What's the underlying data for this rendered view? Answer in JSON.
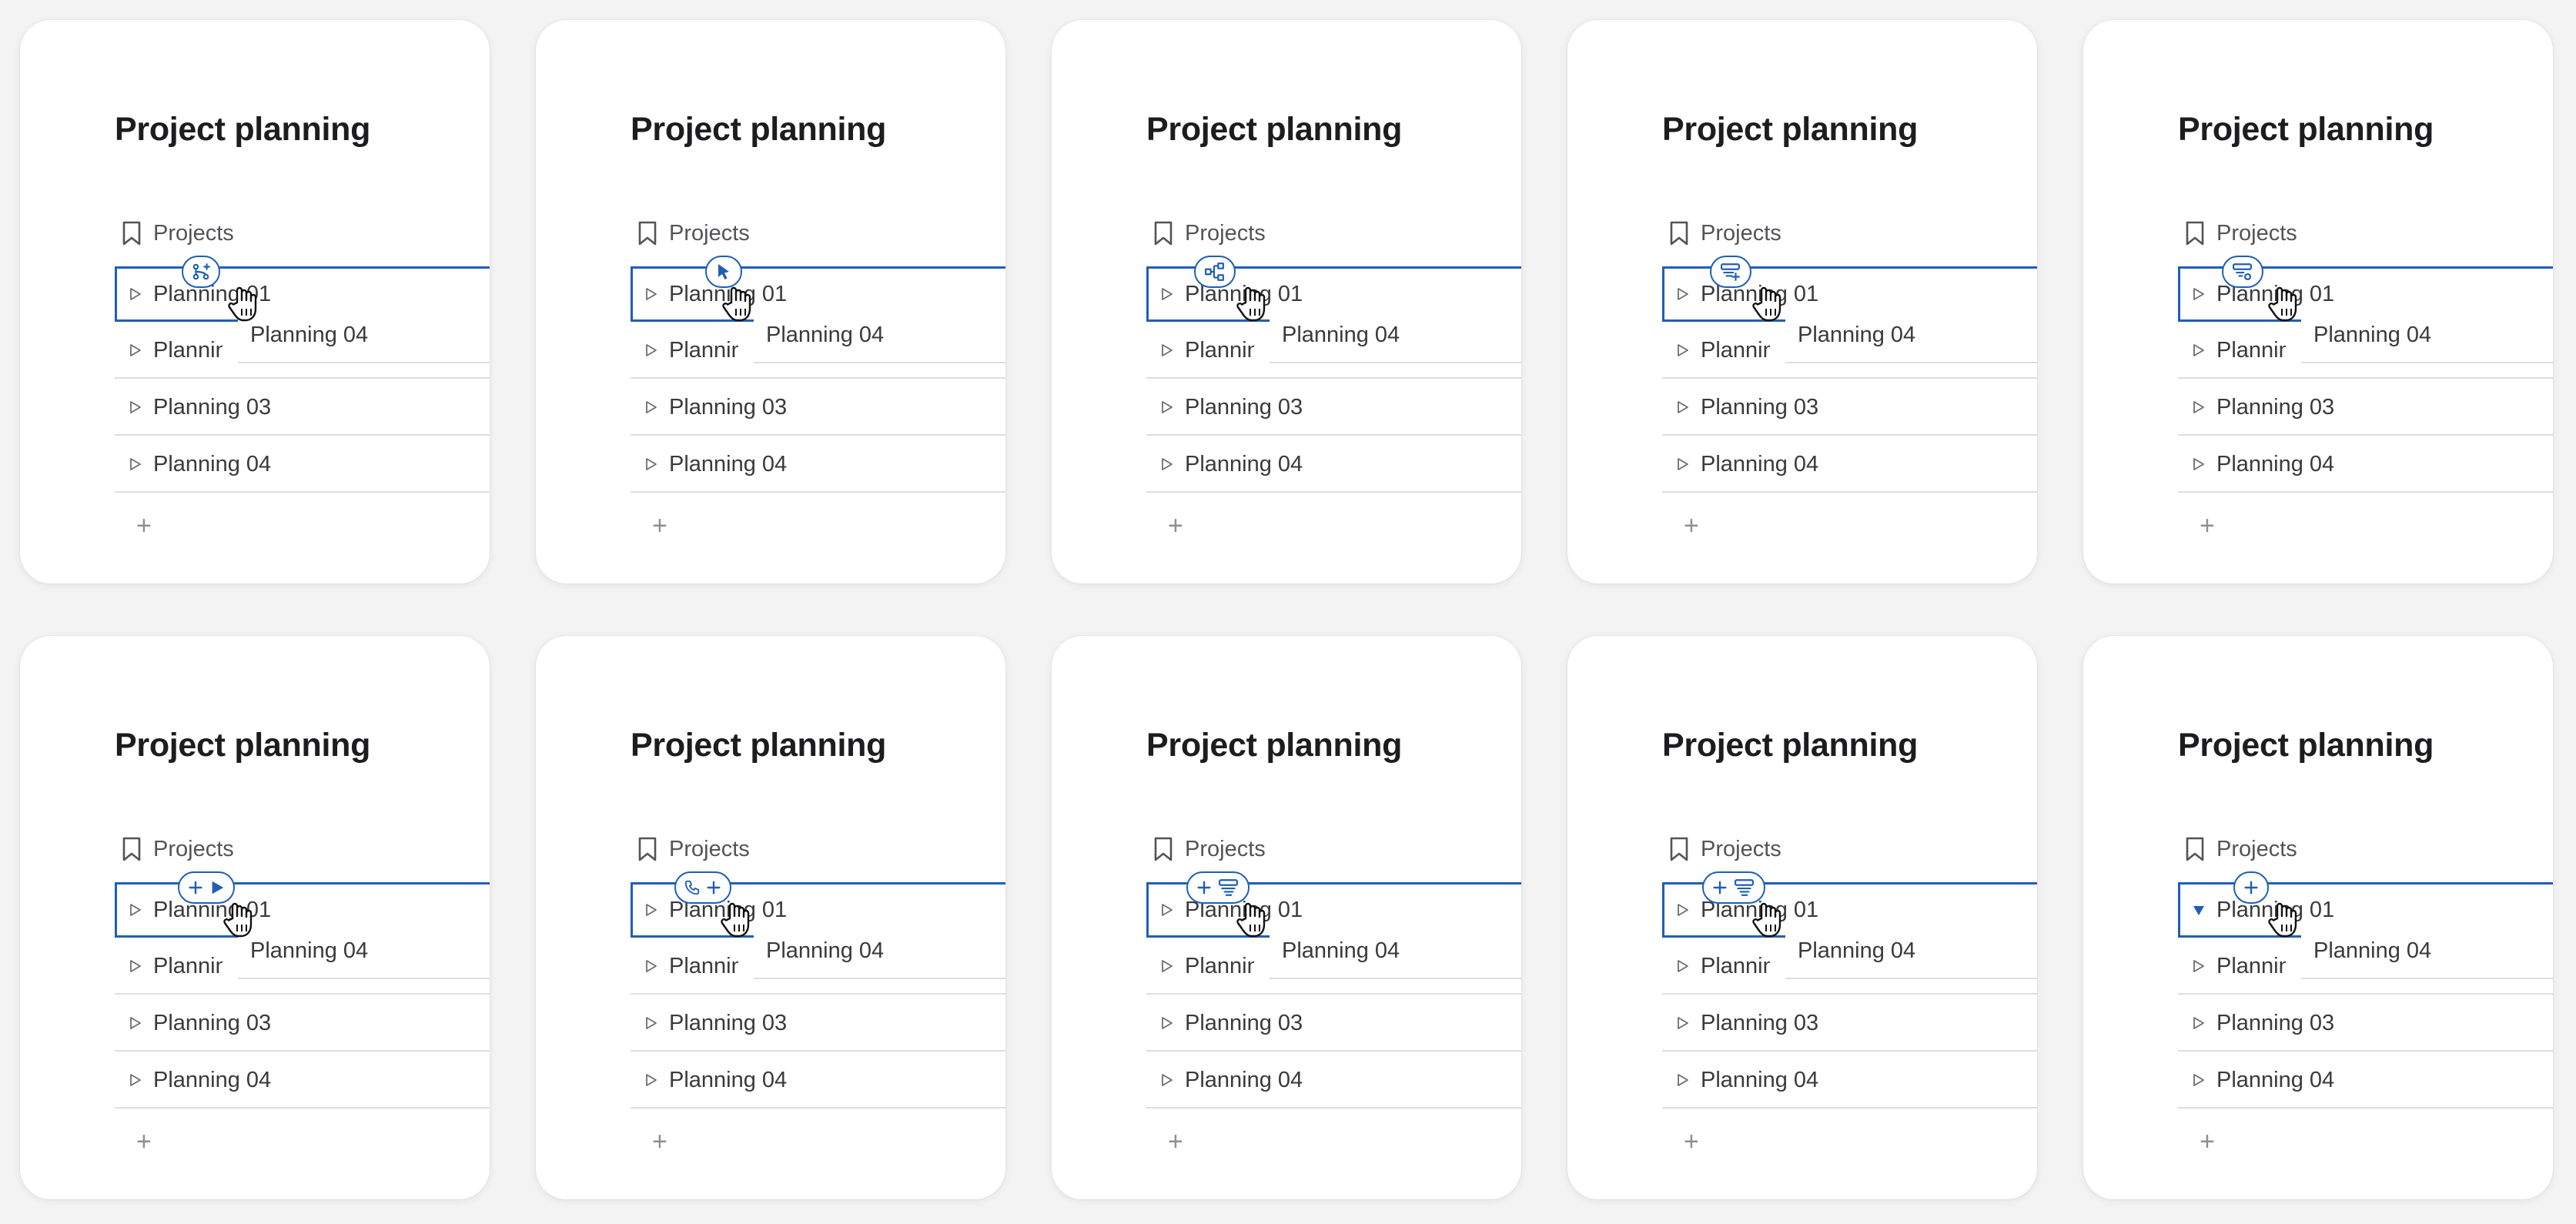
{
  "cards": [
    {
      "title": "Project planning",
      "section": "Projects",
      "rows": [
        "Planning 01",
        "Planning 02",
        "Planning 03",
        "Planning 04"
      ],
      "drag_item": "Planning 04",
      "add": "+",
      "badge": [
        "merge-add-icon"
      ],
      "expanded": false
    },
    {
      "title": "Project planning",
      "section": "Projects",
      "rows": [
        "Planning 01",
        "Planning 02",
        "Planning 03",
        "Planning 04"
      ],
      "drag_item": "Planning 04",
      "add": "+",
      "badge": [
        "pointer-arrow-icon"
      ],
      "expanded": false
    },
    {
      "title": "Project planning",
      "section": "Projects",
      "rows": [
        "Planning 01",
        "Planning 02",
        "Planning 03",
        "Planning 04"
      ],
      "drag_item": "Planning 04",
      "add": "+",
      "badge": [
        "workflow-icon"
      ],
      "expanded": false
    },
    {
      "title": "Project planning",
      "section": "Projects",
      "rows": [
        "Planning 01",
        "Planning 02",
        "Planning 03",
        "Planning 04"
      ],
      "drag_item": "Planning 04",
      "add": "+",
      "badge": [
        "stack-add-icon"
      ],
      "expanded": false
    },
    {
      "title": "Project planning",
      "section": "Projects",
      "rows": [
        "Planning 01",
        "Planning 02",
        "Planning 03",
        "Planning 04"
      ],
      "drag_item": "Planning 04",
      "add": "+",
      "badge": [
        "stack-settings-icon"
      ],
      "expanded": false
    },
    {
      "title": "Project planning",
      "section": "Projects",
      "rows": [
        "Planning 01",
        "Planning 02",
        "Planning 03",
        "Planning 04"
      ],
      "drag_item": "Planning 04",
      "add": "+",
      "badge": [
        "plus-icon",
        "play-icon"
      ],
      "expanded": false
    },
    {
      "title": "Project planning",
      "section": "Projects",
      "rows": [
        "Planning 01",
        "Planning 02",
        "Planning 03",
        "Planning 04"
      ],
      "drag_item": "Planning 04",
      "add": "+",
      "badge": [
        "phone-icon",
        "plus-icon"
      ],
      "expanded": false
    },
    {
      "title": "Project planning",
      "section": "Projects",
      "rows": [
        "Planning 01",
        "Planning 02",
        "Planning 03",
        "Planning 04"
      ],
      "drag_item": "Planning 04",
      "add": "+",
      "badge": [
        "plus-icon",
        "stack-icon"
      ],
      "expanded": false
    },
    {
      "title": "Project planning",
      "section": "Projects",
      "rows": [
        "Planning 01",
        "Planning 02",
        "Planning 03",
        "Planning 04"
      ],
      "drag_item": "Planning 04",
      "add": "+",
      "badge": [
        "plus-icon",
        "stack-icon"
      ],
      "expanded": false
    },
    {
      "title": "Project planning",
      "section": "Projects",
      "rows": [
        "Planning 01",
        "Planning 02",
        "Planning 03",
        "Planning 04"
      ],
      "drag_item": "Planning 04",
      "add": "+",
      "badge": [
        "plus-icon"
      ],
      "expanded": true
    }
  ],
  "colors": {
    "accent": "#1f5fb4",
    "text": "#3a3a3c",
    "muted": "#8e8e93"
  }
}
